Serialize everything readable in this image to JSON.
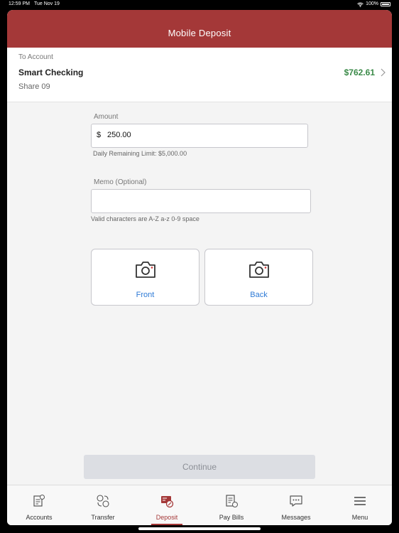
{
  "status_bar": {
    "time": "12:59 PM",
    "date": "Tue Nov 19",
    "battery": "100%"
  },
  "header": {
    "title": "Mobile Deposit"
  },
  "account": {
    "label": "To Account",
    "name": "Smart Checking",
    "share": "Share 09",
    "balance": "$762.61"
  },
  "amount": {
    "label": "Amount",
    "currency": "$",
    "value": "250.00",
    "helper": "Daily Remaining Limit: $5,000.00"
  },
  "memo": {
    "label": "Memo (Optional)",
    "value": "",
    "helper": "Valid characters are A-Z a-z 0-9 space"
  },
  "capture": {
    "front_label": "Front",
    "back_label": "Back"
  },
  "continue_label": "Continue",
  "tabs": [
    {
      "label": "Accounts",
      "icon": "accounts-icon"
    },
    {
      "label": "Transfer",
      "icon": "transfer-icon"
    },
    {
      "label": "Deposit",
      "icon": "deposit-icon",
      "active": true
    },
    {
      "label": "Pay Bills",
      "icon": "pay-bills-icon"
    },
    {
      "label": "Messages",
      "icon": "messages-icon"
    },
    {
      "label": "Menu",
      "icon": "menu-icon"
    }
  ],
  "colors": {
    "brand": "#a43838",
    "balance": "#3a8a48",
    "link": "#2d7ad6"
  }
}
